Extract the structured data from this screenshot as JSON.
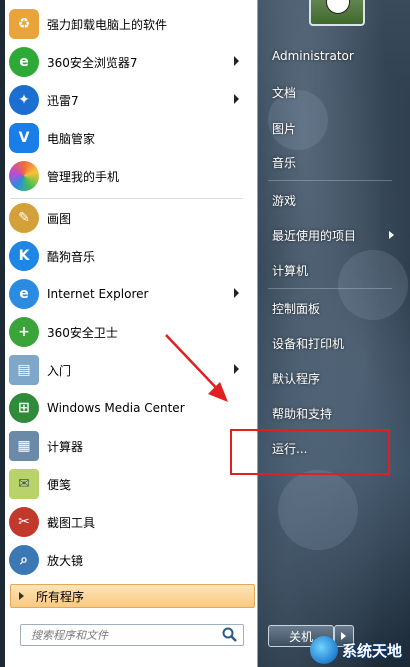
{
  "pinned_programs": [
    {
      "label": "强力卸载电脑上的软件",
      "icon": "uninstaller-icon",
      "color": "#e8a33a",
      "has_submenu": false
    },
    {
      "label": "360安全浏览器7",
      "icon": "360-browser-icon",
      "color": "#2ea836",
      "has_submenu": true
    },
    {
      "label": "迅雷7",
      "icon": "thunder-bird-icon",
      "color": "#1b6fd1",
      "has_submenu": true
    },
    {
      "label": "电脑管家",
      "icon": "shield-icon",
      "color": "#1a7ee8",
      "has_submenu": false
    },
    {
      "label": "管理我的手机",
      "icon": "phone-manager-icon",
      "color": "#f06a3a",
      "has_submenu": false
    }
  ],
  "recent_programs": [
    {
      "label": "画图",
      "icon": "paint-palette-icon",
      "color": "#d4a03a",
      "has_submenu": false
    },
    {
      "label": "酷狗音乐",
      "icon": "kugou-k-icon",
      "color": "#1f86e5",
      "has_submenu": false
    },
    {
      "label": "Internet Explorer",
      "icon": "ie-icon",
      "color": "#2a8be0",
      "has_submenu": true
    },
    {
      "label": "360安全卫士",
      "icon": "360-guard-plus-icon",
      "color": "#3aa33a",
      "has_submenu": false
    },
    {
      "label": "入门",
      "icon": "getting-started-icon",
      "color": "#7fa7c9",
      "has_submenu": true
    },
    {
      "label": "Windows Media Center",
      "icon": "windows-logo-icon",
      "color": "#2f8a3a",
      "has_submenu": false
    },
    {
      "label": "计算器",
      "icon": "calculator-icon",
      "color": "#6a8aa8",
      "has_submenu": false
    },
    {
      "label": "便笺",
      "icon": "sticky-note-icon",
      "color": "#b9d36a",
      "has_submenu": false
    },
    {
      "label": "截图工具",
      "icon": "scissors-icon",
      "color": "#c0392b",
      "has_submenu": false
    },
    {
      "label": "放大镜",
      "icon": "magnifier-icon",
      "color": "#3c78b4",
      "has_submenu": false
    }
  ],
  "all_programs_label": "所有程序",
  "search": {
    "placeholder": "搜索程序和文件"
  },
  "right_menu": [
    {
      "label": "Administrator",
      "has_submenu": false
    },
    {
      "label": "文档",
      "has_submenu": false
    },
    {
      "label": "图片",
      "has_submenu": false
    },
    {
      "label": "音乐",
      "has_submenu": false
    },
    {
      "label": "游戏",
      "has_submenu": false
    },
    {
      "label": "最近使用的项目",
      "has_submenu": true
    },
    {
      "label": "计算机",
      "has_submenu": false
    },
    {
      "label": "控制面板",
      "has_submenu": false
    },
    {
      "label": "设备和打印机",
      "has_submenu": false
    },
    {
      "label": "默认程序",
      "has_submenu": false
    },
    {
      "label": "帮助和支持",
      "has_submenu": false
    },
    {
      "label": "运行...",
      "has_submenu": false
    }
  ],
  "shutdown_label": "关机",
  "watermark_text": "系统天地",
  "annotation_color": "#e02020"
}
